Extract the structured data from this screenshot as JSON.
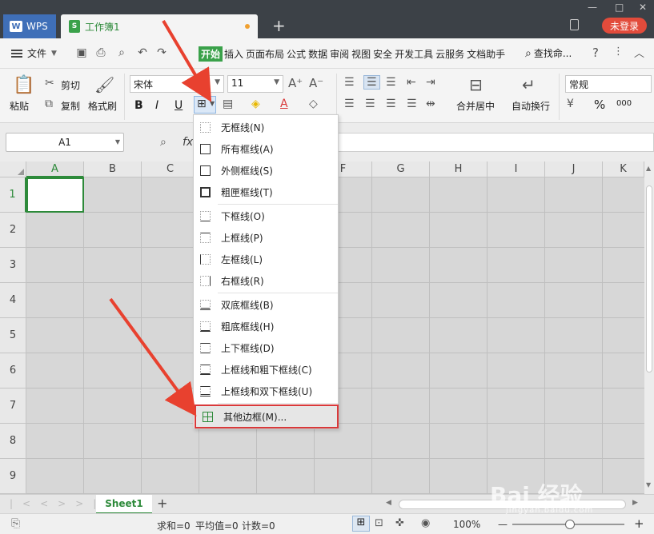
{
  "titlebar": {
    "app_tab": "WPS",
    "doc_tab": "工作簿1",
    "doc_icon": "S",
    "add_tab": "+",
    "login": "未登录",
    "win_min": "—",
    "win_max": "□",
    "win_close": "✕"
  },
  "menubar": {
    "file": "文件",
    "tabs": [
      "开始",
      "插入",
      "页面布局",
      "公式",
      "数据",
      "审阅",
      "视图",
      "安全",
      "开发工具",
      "云服务",
      "文档助手"
    ],
    "search": "查找命...",
    "help": "?"
  },
  "ribbon": {
    "paste": "粘贴",
    "cut": "剪切",
    "copy": "复制",
    "format_painter": "格式刷",
    "font_name": "宋体",
    "font_size": "11",
    "bold": "B",
    "italic": "I",
    "underline": "U",
    "merge_center": "合并居中",
    "wrap_text": "自动换行",
    "number_format": "常规",
    "percent": "%",
    "comma": "000"
  },
  "formula": {
    "name_box": "A1",
    "fx": "fx"
  },
  "grid": {
    "columns": [
      "A",
      "B",
      "C",
      "D",
      "E",
      "F",
      "G",
      "H",
      "I",
      "J",
      "K"
    ],
    "rows": [
      "1",
      "2",
      "3",
      "4",
      "5",
      "6",
      "7",
      "8",
      "9"
    ]
  },
  "border_menu": {
    "groups": [
      [
        "无框线(N)",
        "所有框线(A)",
        "外侧框线(S)",
        "粗匣框线(T)"
      ],
      [
        "下框线(O)",
        "上框线(P)",
        "左框线(L)",
        "右框线(R)"
      ],
      [
        "双底框线(B)",
        "粗底框线(H)",
        "上下框线(D)",
        "上框线和粗下框线(C)",
        "上框线和双下框线(U)"
      ],
      [
        "其他边框(M)..."
      ]
    ],
    "highlight_color": "#d9393a"
  },
  "sheets": {
    "tabs": [
      "Sheet1"
    ],
    "add": "+"
  },
  "status": {
    "sum": "求和=0",
    "avg": "平均值=0",
    "count": "计数=0",
    "zoom": "100%",
    "zoom_minus": "—",
    "zoom_plus": "+"
  },
  "watermark": {
    "main": "Bai 经验",
    "sub": "jingyan.baidu.com"
  },
  "colors": {
    "accent": "#3aa14a",
    "arrow": "#e8412f",
    "login": "#e24b3b"
  }
}
